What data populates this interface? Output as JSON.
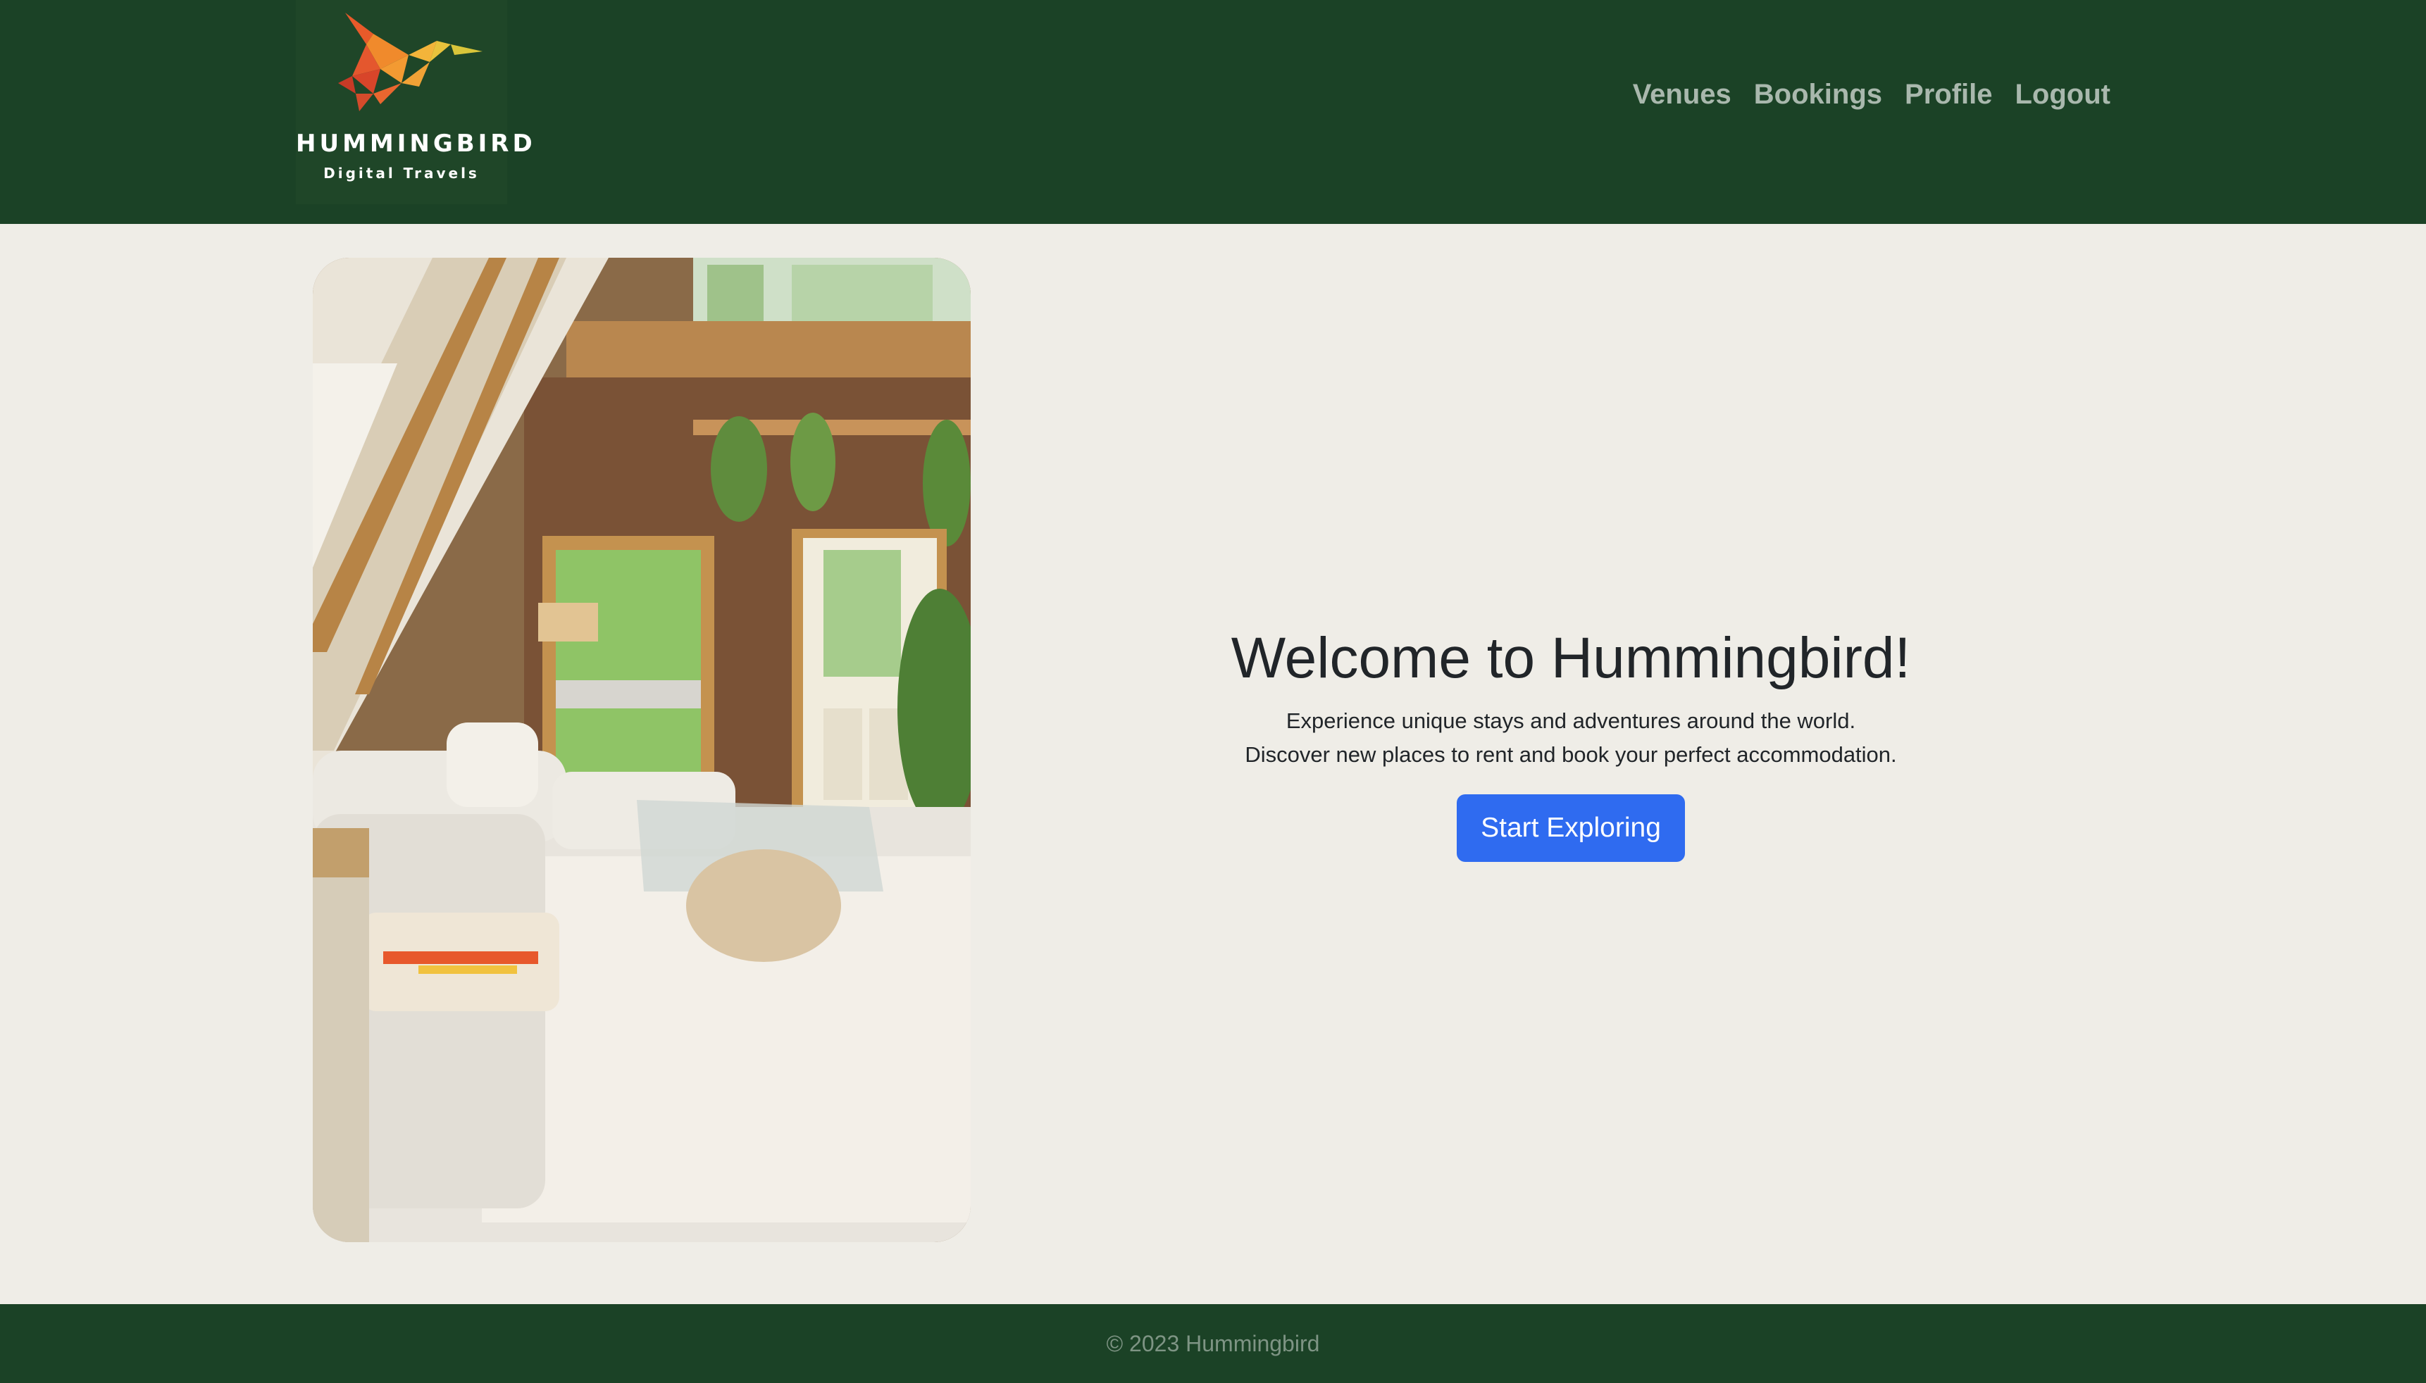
{
  "brand": {
    "name": "HUMMINGBIRD",
    "tagline": "Digital Travels",
    "colors": {
      "header_bg": "#1b4226",
      "page_bg": "#efede7",
      "accent": "#2f6bf0"
    }
  },
  "nav": {
    "items": [
      {
        "label": "Venues",
        "icon": null
      },
      {
        "label": "Bookings",
        "icon": null
      },
      {
        "label": "Profile",
        "icon": null
      },
      {
        "label": "Logout",
        "icon": null
      }
    ]
  },
  "hero": {
    "image_icon": "living-room-photo",
    "title": "Welcome to Hummingbird!",
    "line1": "Experience unique stays and adventures around the world.",
    "line2": "Discover new places to rent and book your perfect accommodation.",
    "cta_label": "Start Exploring"
  },
  "footer": {
    "text": "© 2023 Hummingbird"
  }
}
